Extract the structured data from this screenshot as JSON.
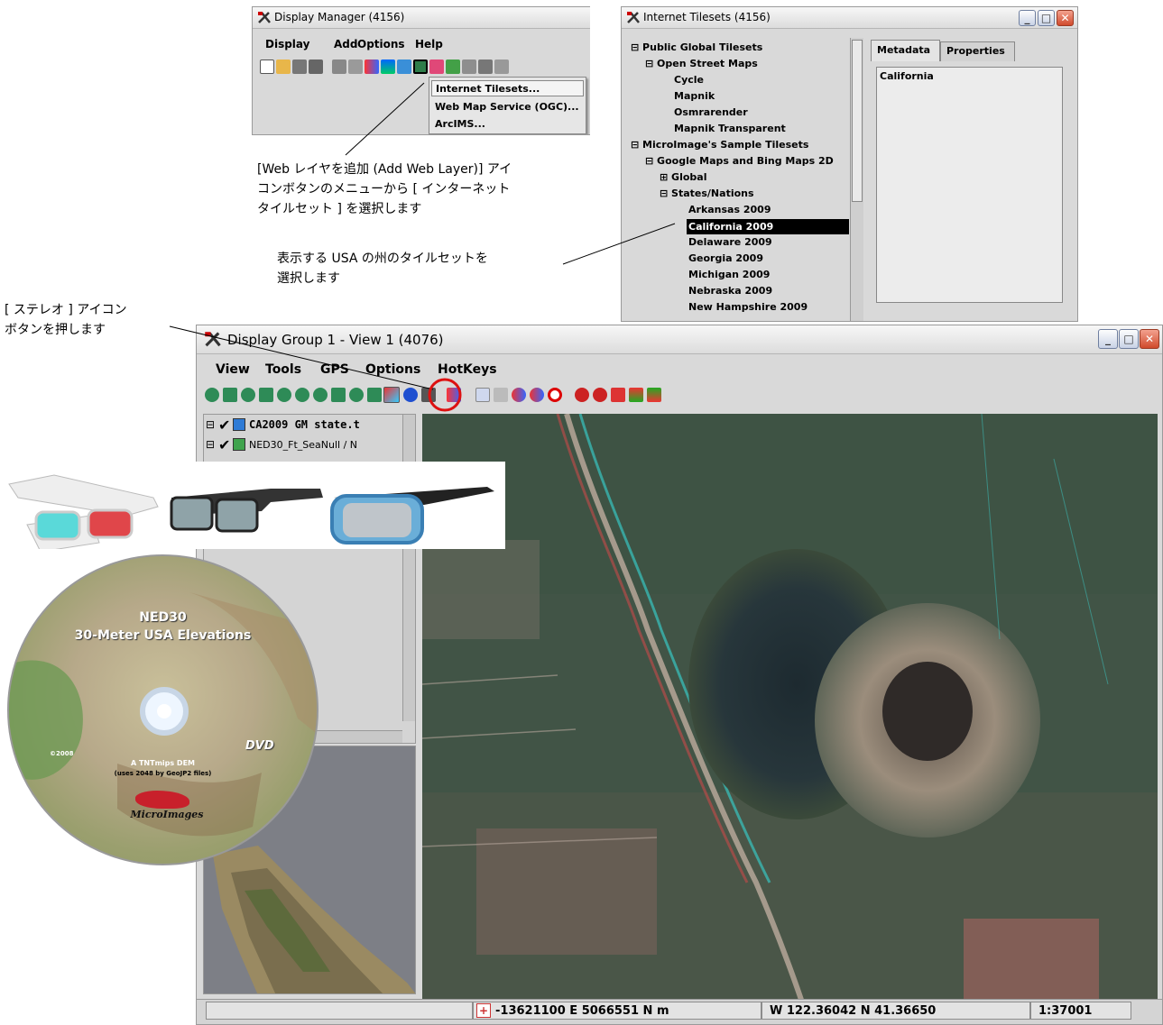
{
  "display_manager": {
    "title": "Display Manager (4156)",
    "menu": [
      "Display",
      "Add",
      "Options",
      "Help"
    ],
    "dropdown": [
      "Internet Tilesets...",
      "Web Map Service (OGC)...",
      "ArcIMS..."
    ]
  },
  "internet_tilesets": {
    "title": "Internet Tilesets (4156)",
    "tree": [
      "⊟ Public Global Tilesets",
      "⊟ Open Street Maps",
      "Cycle",
      "Mapnik",
      "Osmrarender",
      "Mapnik Transparent",
      "⊟ MicroImage's Sample Tilesets",
      "⊟ Google Maps and Bing Maps 2D",
      "⊞ Global",
      "⊟ States/Nations",
      "Arkansas 2009",
      "California 2009",
      "Delaware 2009",
      "Georgia 2009",
      "Michigan 2009",
      "Nebraska 2009",
      "New Hampshire 2009"
    ],
    "selected_item": "California 2009",
    "tabs": [
      "Metadata",
      "Properties"
    ],
    "metadata_text": "California"
  },
  "notes": {
    "web_layer": [
      "[Web レイヤを追加 (Add Web Layer)] アイ",
      "コンボタンのメニューから [ インターネット",
      "タイルセット ] を選択します"
    ],
    "state_select": [
      "表示する USA の州のタイルセットを",
      "選択します"
    ],
    "stereo": [
      "[ ステレオ ] アイコン",
      "ボタンを押します"
    ]
  },
  "view_window": {
    "title": "Display Group 1 - View 1 (4076)",
    "menu": [
      "View",
      "Tools",
      "GPS",
      "Options",
      "HotKeys"
    ],
    "layers": [
      "CA2009 GM state.t",
      "NED30_Ft_SeaNull / N"
    ],
    "status": {
      "coords_map": "-13621100 E  5066551 N m",
      "coords_geo": "W 122.36042  N 41.36650",
      "scale": "1:37001"
    }
  },
  "dvd": {
    "title": "NED30",
    "subtitle": "30-Meter USA Elevations",
    "year": "©2008",
    "format": "DVD",
    "line1": "A TNTmips DEM",
    "line2": "(uses 2048 by GeoJP2 files)",
    "logo": "MicroImages"
  },
  "colors": {
    "selection": "#000000",
    "highlight_circle": "#dd1111",
    "title_bar": "#e6e6e6"
  }
}
